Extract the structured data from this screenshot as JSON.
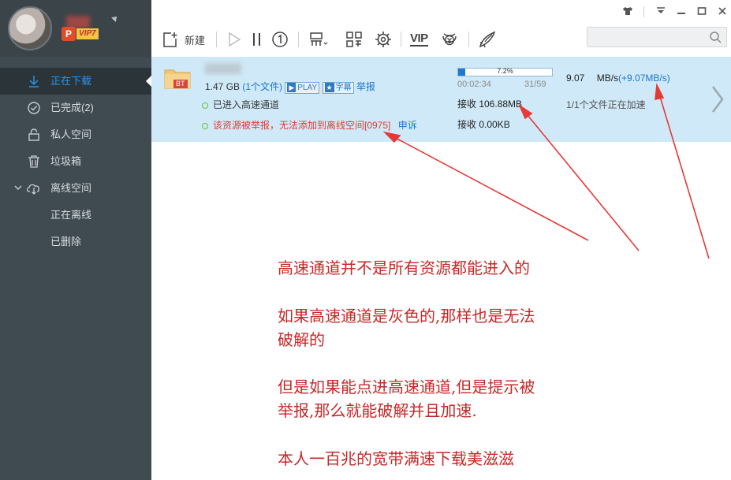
{
  "sidebar": {
    "vip_label": "VIP7",
    "items": [
      {
        "label": "正在下载",
        "icon": "download-arrow-icon",
        "active": true
      },
      {
        "label": "已完成(2)",
        "icon": "check-circle-icon"
      },
      {
        "label": "私人空间",
        "icon": "lock-icon"
      },
      {
        "label": "垃圾箱",
        "icon": "trash-icon"
      },
      {
        "label": "离线空间",
        "icon": "cloud-download-icon",
        "expanded": true
      },
      {
        "label": "正在离线",
        "sub": true
      },
      {
        "label": "已删除",
        "sub": true
      }
    ]
  },
  "toolbar": {
    "new_label": "新建",
    "vip_label": "VIP",
    "search": {
      "value": "",
      "placeholder": ""
    }
  },
  "task": {
    "size_text": "1.47 GB",
    "file_count": "(1个文件)",
    "play_label": "PLAY",
    "subtitle_label": "字幕",
    "report_label": "举报",
    "bt_label": "BT",
    "status_line1": "已进入高速通道",
    "status_line2": "该资源被举报，无法添加到离线空间[0975]",
    "appeal_label": "申诉",
    "progress_percent": 7.2,
    "progress_text": "7.2%",
    "elapsed": "00:02:34",
    "pieces": "31/59",
    "received_label": "接收 106.88MB",
    "received2_label": "接收 0.00KB",
    "speed_value": "9.07",
    "speed_unit": "MB/s",
    "speed_bonus": "(+9.07MB/s)",
    "accel_status": "1/1个文件正在加速"
  },
  "annotation": {
    "lines": [
      "高速通道并不是所有资源都能进入的",
      "如果高速通道是灰色的,那样也是无法",
      "破解的",
      "但是如果能点进高速通道,但是提示被",
      "举报,那么就能破解并且加速.",
      "本人一百兆的宽带满速下载美滋滋"
    ],
    "color": "#c62828"
  },
  "colors": {
    "sidebar_bg": "#3f4a51",
    "accent": "#2a93e8",
    "task_bg": "#cfe9f8",
    "annotation": "#e53935"
  }
}
